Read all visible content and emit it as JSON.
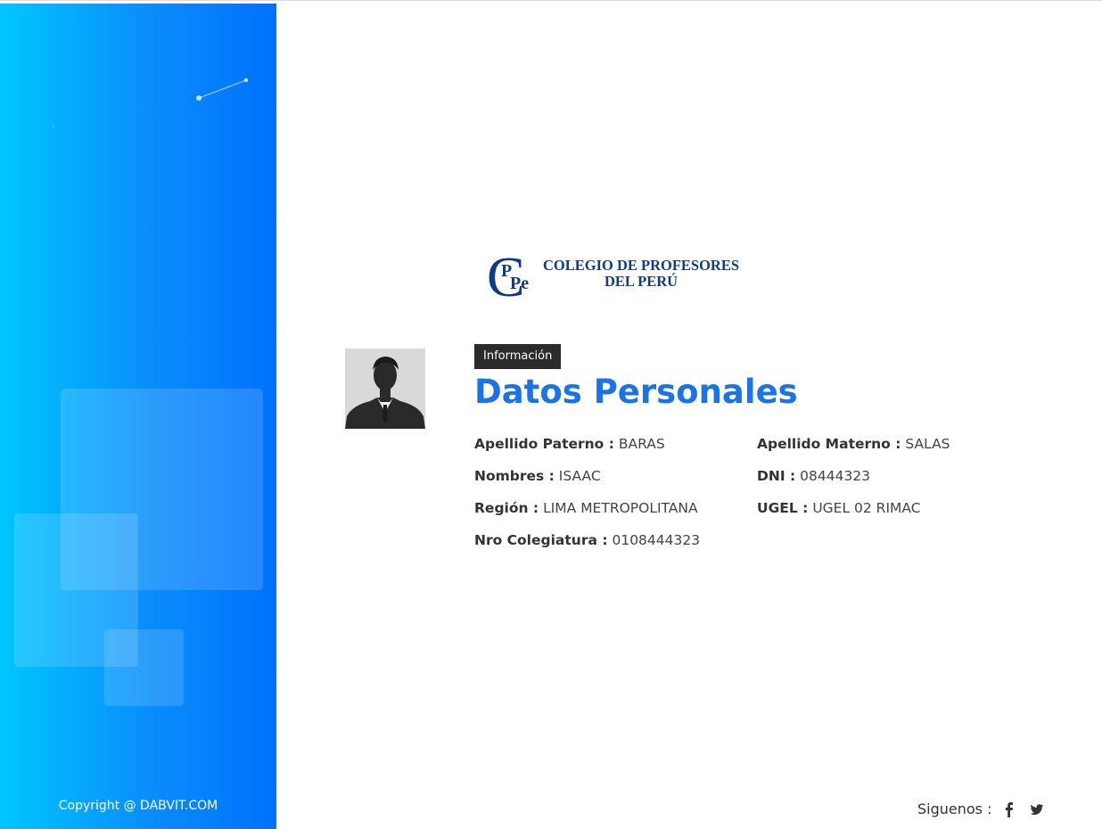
{
  "sidebar": {
    "copyright": "Copyright @ DABVIT.COM"
  },
  "logo": {
    "monogram": "CPPe",
    "line1": "COLEGIO DE PROFESORES",
    "line2": "DEL PERÚ"
  },
  "profile": {
    "badge": "Información",
    "title": "Datos Personales",
    "fields": [
      {
        "label": "Apellido Paterno :",
        "value": "BARAS"
      },
      {
        "label": "Apellido Materno :",
        "value": "SALAS"
      },
      {
        "label": "Nombres :",
        "value": "ISAAC"
      },
      {
        "label": "DNI :",
        "value": "08444323"
      },
      {
        "label": "Región :",
        "value": "LIMA METROPOLITANA"
      },
      {
        "label": "UGEL :",
        "value": "UGEL 02 RIMAC"
      },
      {
        "label": "Nro Colegiatura :",
        "value": "0108444323"
      }
    ]
  },
  "footer": {
    "follow_label": "Siguenos :",
    "social": [
      "facebook-icon",
      "twitter-icon"
    ]
  },
  "colors": {
    "sidebar_start": "#00c6ff",
    "sidebar_end": "#0072ff",
    "title": "#1a73e8",
    "badge_bg": "#2b2b2b",
    "logo": "#123b86"
  }
}
